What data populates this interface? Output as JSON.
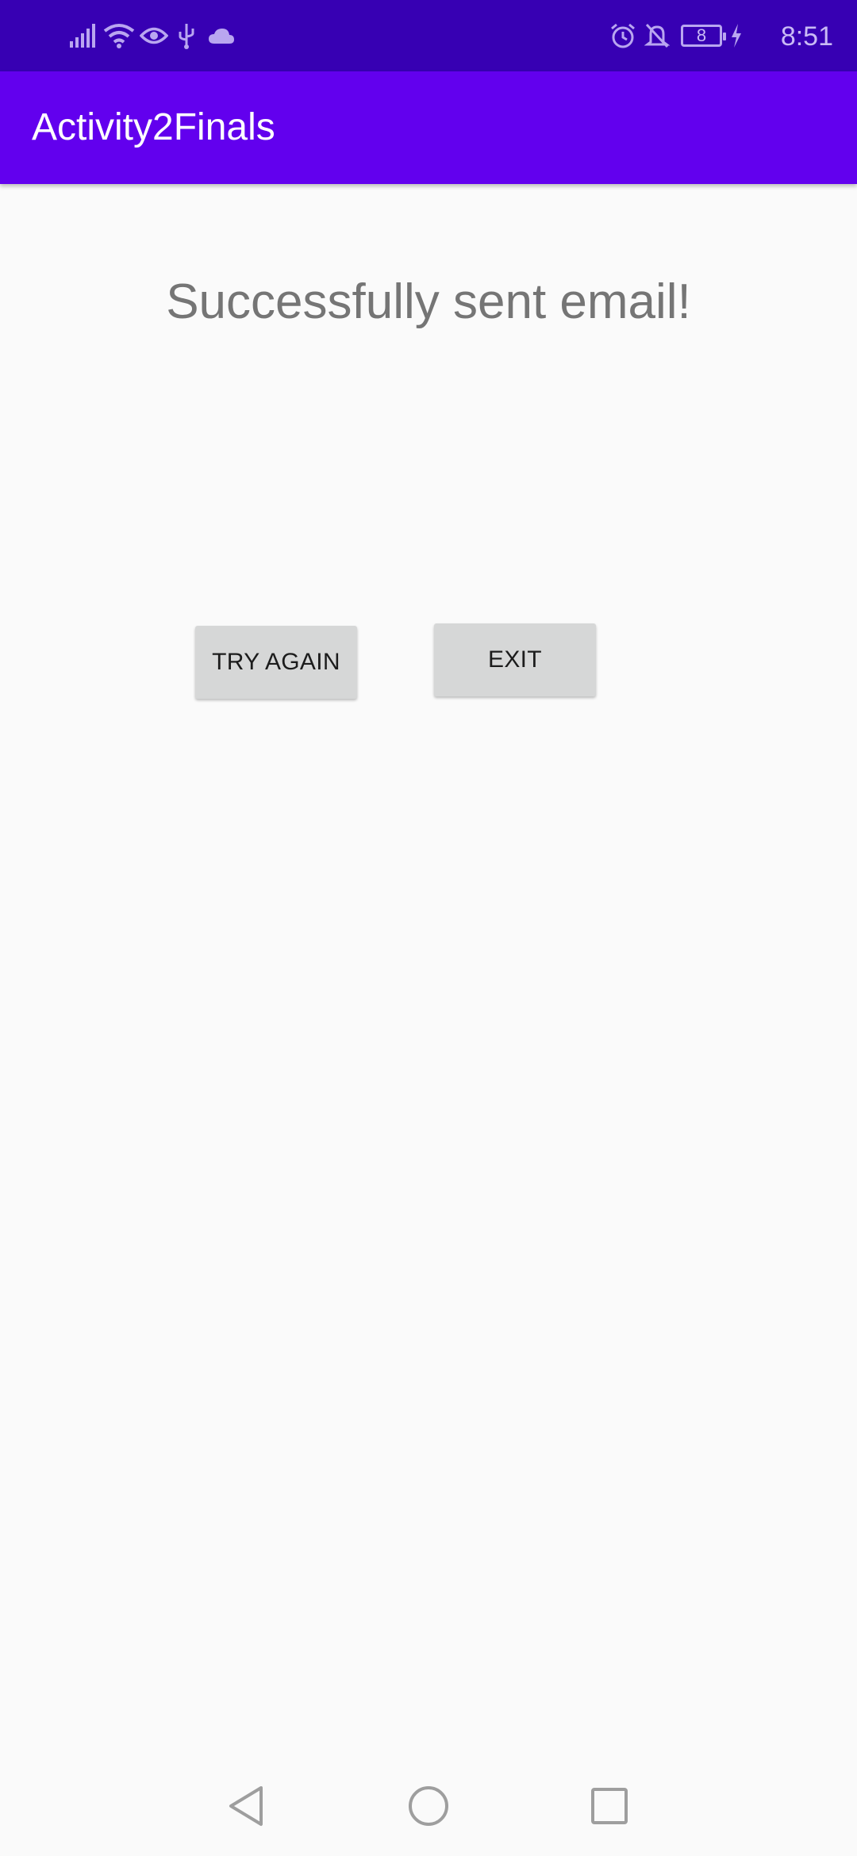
{
  "status_bar": {
    "time": "8:51",
    "battery_level": "8",
    "left_icons": [
      "signal-icon",
      "wifi-icon",
      "eye-icon",
      "usb-icon",
      "cloud-icon"
    ],
    "right_icons": [
      "alarm-icon",
      "notifications-off-icon",
      "battery-icon",
      "charging-icon"
    ]
  },
  "app_bar": {
    "title": "Activity2Finals"
  },
  "content": {
    "message": "Successfully sent email!",
    "try_again_label": "TRY AGAIN",
    "exit_label": "EXIT"
  },
  "nav_bar": {
    "buttons": [
      "back-icon",
      "home-icon",
      "recents-icon"
    ]
  },
  "colors": {
    "status_bar": "#3700B3",
    "app_bar": "#6200EE",
    "background": "#FAFAFA",
    "button": "#D6D7D7",
    "message_text": "#757575"
  }
}
